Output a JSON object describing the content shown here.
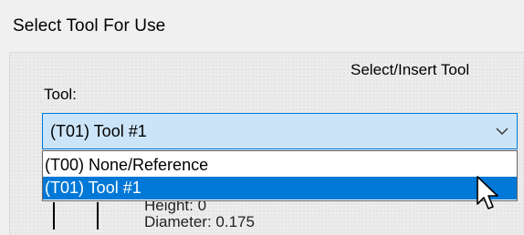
{
  "dialog": {
    "title": "Select Tool For Use"
  },
  "section": {
    "title": "Select/Insert Tool"
  },
  "tool_field": {
    "label": "Tool:",
    "selected_value": "(T01) Tool #1",
    "chevron_icon": "chevron-down-icon",
    "options": [
      {
        "label": "(T00) None/Reference",
        "highlighted": false
      },
      {
        "label": "(T01) Tool #1",
        "highlighted": true
      }
    ]
  },
  "details": {
    "height_line": "Height: 0",
    "diameter_line": "Diameter: 0.175"
  },
  "colors": {
    "combo_background": "#cce4f7",
    "combo_border": "#0078d7",
    "highlight": "#0078d7",
    "dialog_background": "#f0f0f0"
  },
  "cursor_icon": "arrow-pointer-icon"
}
